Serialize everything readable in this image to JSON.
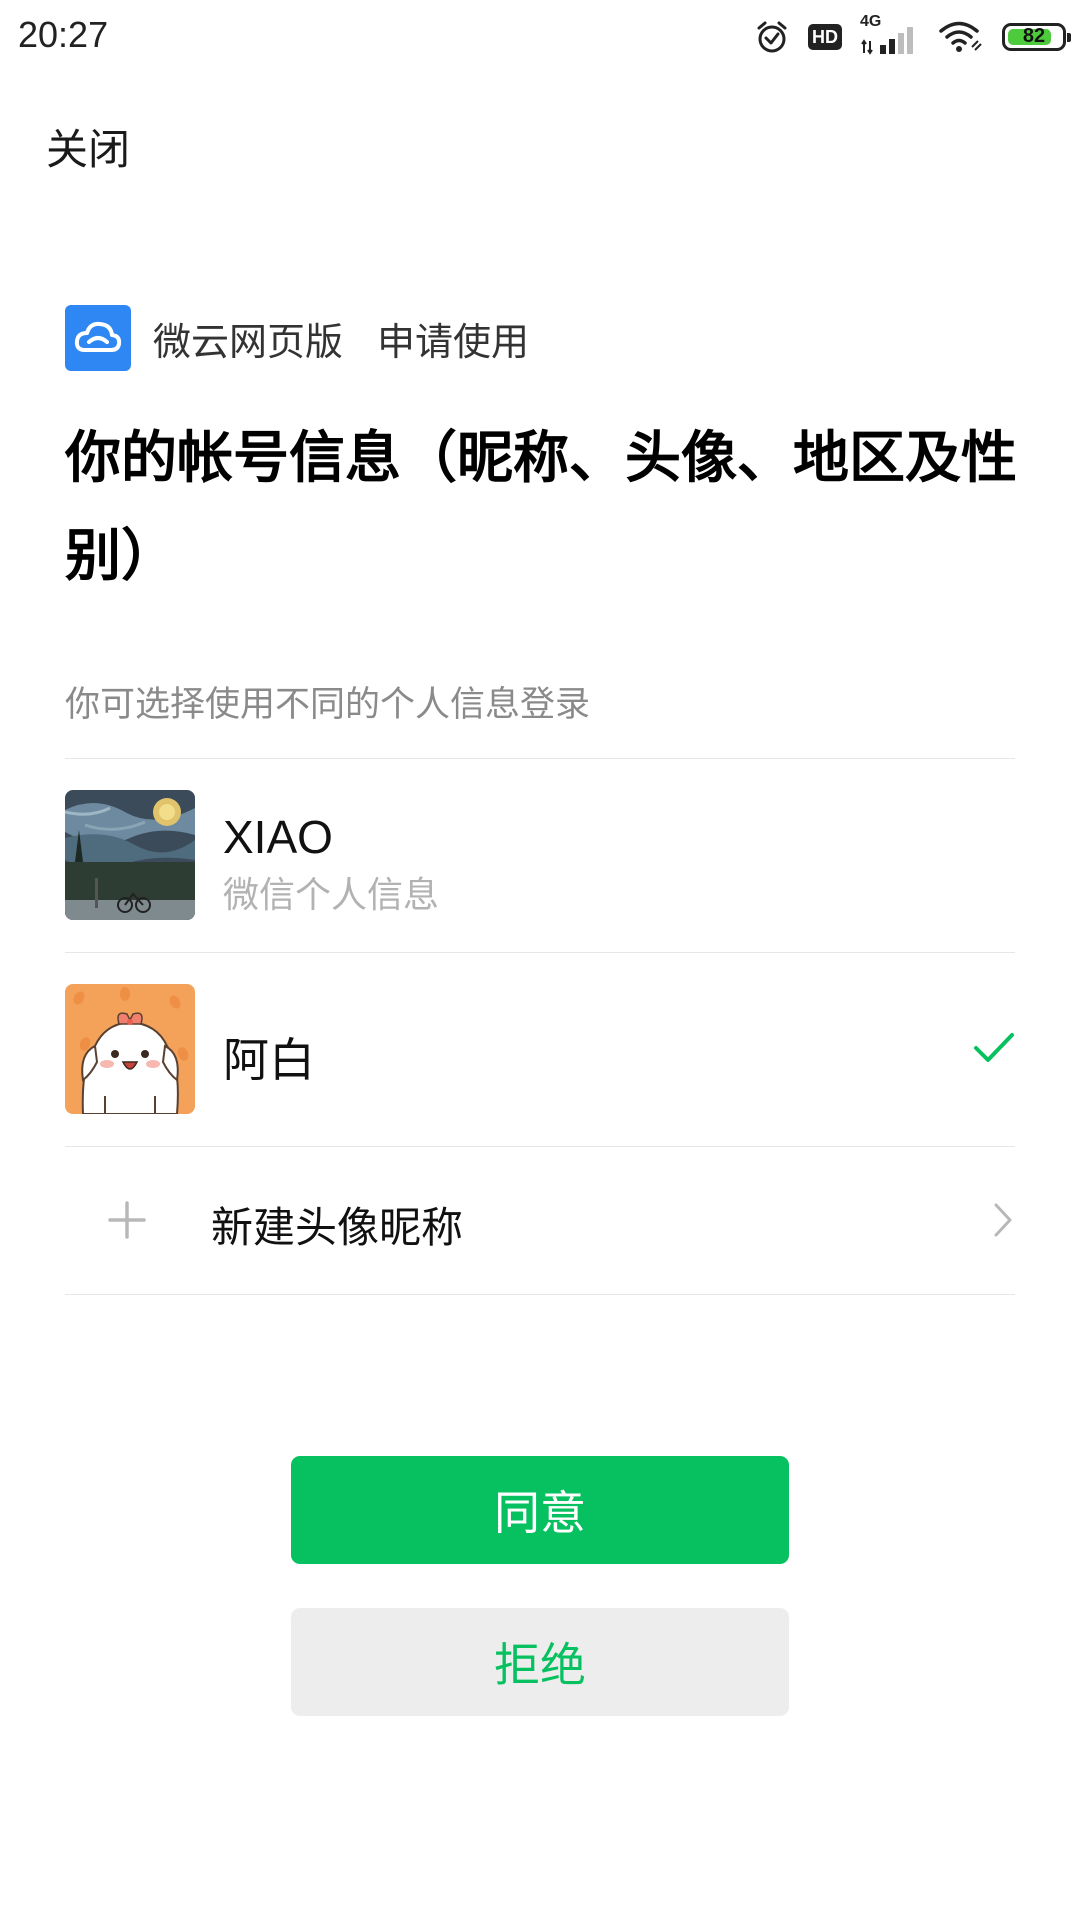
{
  "status_bar": {
    "time": "20:27",
    "network": "4G",
    "hd_label": "HD",
    "battery_percent": 82,
    "battery_label": "82",
    "icons": [
      "alarm-icon",
      "hd-icon",
      "signal-icon",
      "wifi-icon",
      "battery-icon"
    ]
  },
  "header": {
    "close_label": "关闭"
  },
  "app": {
    "name": "微云网页版",
    "request_label": "申请使用",
    "logo_icon": "cloud-icon",
    "logo_color": "#2f87f3"
  },
  "title": "你的帐号信息（昵称、头像、地区及性别）",
  "subtitle": "你可选择使用不同的个人信息登录",
  "profiles": [
    {
      "name": "XIAO",
      "description": "微信个人信息",
      "avatar": "starry-night-painting-avatar",
      "selected": false
    },
    {
      "name": "阿白",
      "description": "",
      "avatar": "cartoon-puppy-avatar",
      "selected": true
    }
  ],
  "new_profile": {
    "label": "新建头像昵称",
    "icon": "plus-icon"
  },
  "buttons": {
    "agree_label": "同意",
    "reject_label": "拒绝"
  },
  "colors": {
    "accent": "#07c160",
    "reject_bg": "#ededed"
  }
}
